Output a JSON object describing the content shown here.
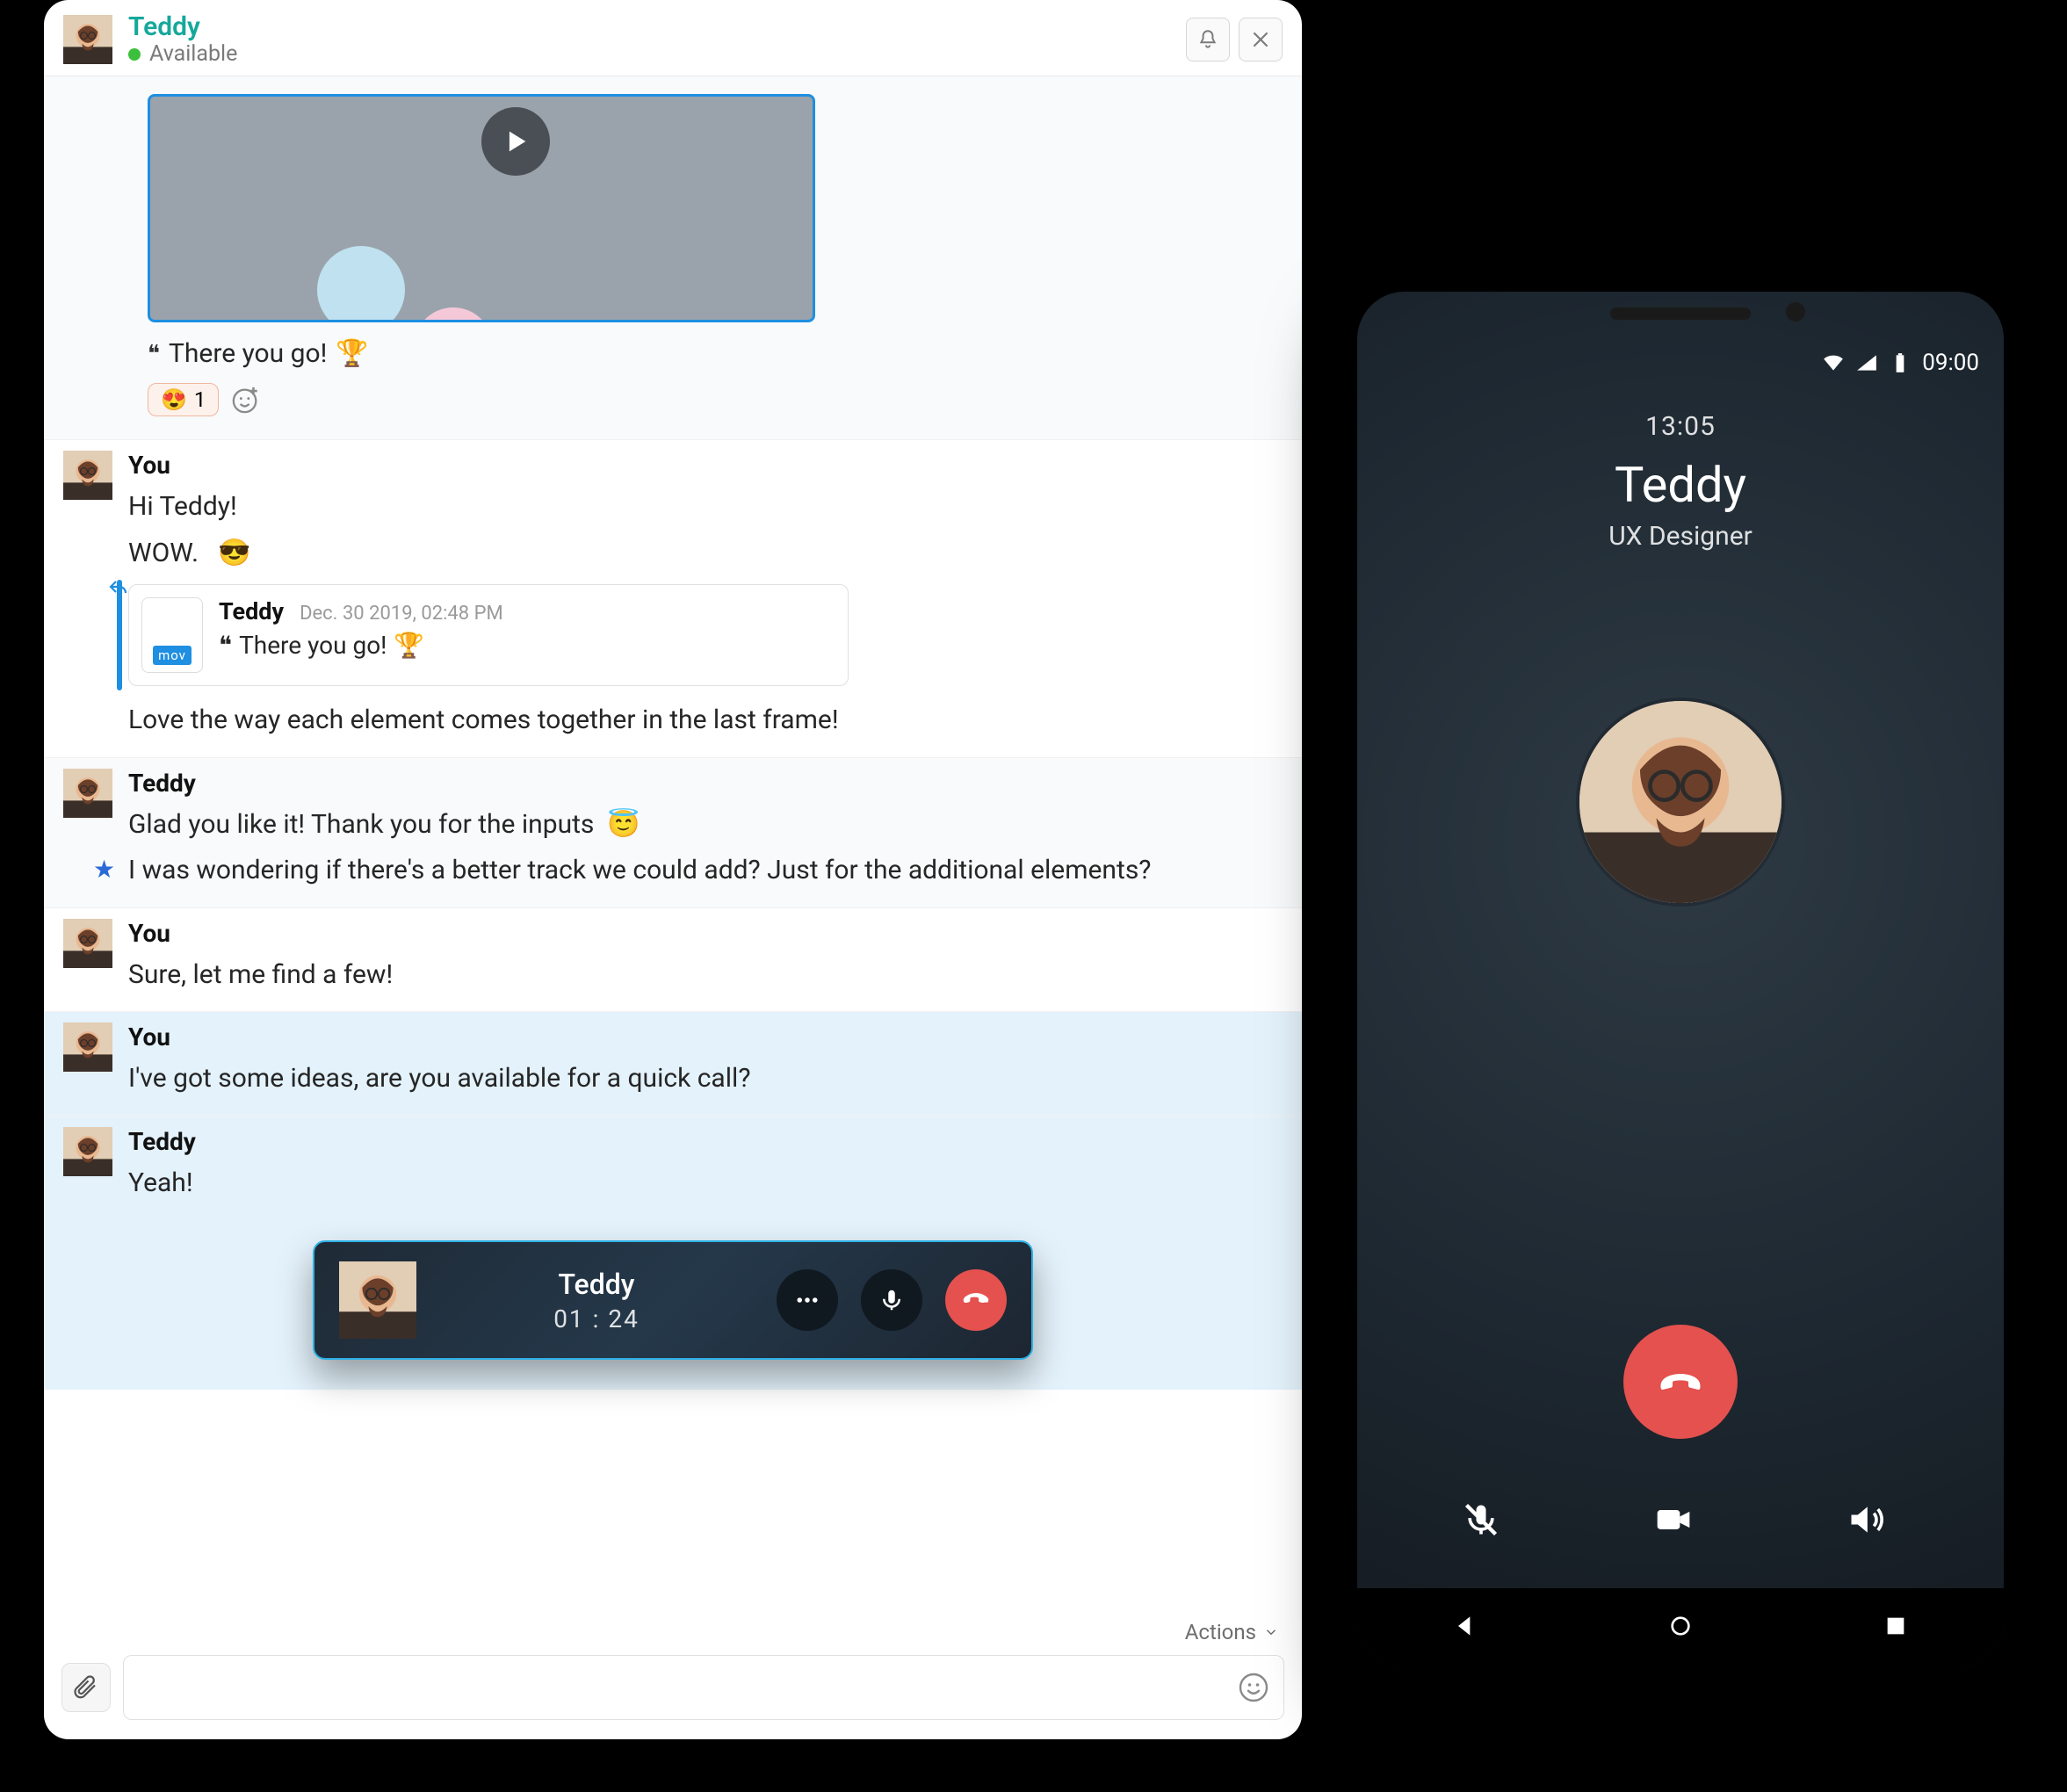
{
  "chat": {
    "header": {
      "name": "Teddy",
      "status": "Available"
    },
    "first": {
      "caption": "There you go!",
      "trophy": "🏆",
      "reaction_emoji": "😍",
      "reaction_count": "1"
    },
    "m1": {
      "sender": "You",
      "line1": "Hi Teddy!",
      "line2a": "WOW.",
      "line2b": "😎",
      "quote": {
        "name": "Teddy",
        "time": "Dec. 30 2019, 02:48 PM",
        "text": "There you go!",
        "trophy": "🏆",
        "ext": "mov"
      },
      "line3": "Love the way each element comes together in the last frame!"
    },
    "m2": {
      "sender": "Teddy",
      "line1a": "Glad you like it! Thank you for the inputs",
      "line1b": "😇",
      "line2": "I was wondering if there's a better track we could add? Just for the additional elements?"
    },
    "m3": {
      "sender": "You",
      "line1": "Sure, let me find a few!"
    },
    "m4": {
      "sender": "You",
      "line1": "I've got some ideas, are you available for a quick call?"
    },
    "m5": {
      "sender": "Teddy",
      "line1": "Yeah!"
    },
    "call_widget": {
      "name": "Teddy",
      "time": "01 : 24"
    },
    "actions_label": "Actions"
  },
  "phone": {
    "status_time": "09:00",
    "call_time": "13:05",
    "caller_name": "Teddy",
    "caller_role": "UX Designer"
  }
}
